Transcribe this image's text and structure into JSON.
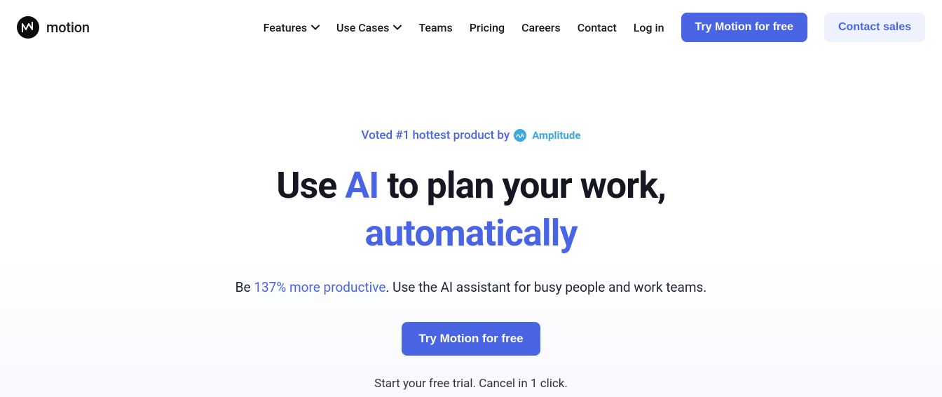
{
  "logo": {
    "text": "motion"
  },
  "nav": {
    "features": "Features",
    "use_cases": "Use Cases",
    "teams": "Teams",
    "pricing": "Pricing",
    "careers": "Careers",
    "contact": "Contact",
    "login": "Log in",
    "try_free": "Try Motion for free",
    "contact_sales": "Contact sales"
  },
  "hero": {
    "badge_text": "Voted #1 hottest product by",
    "badge_brand": "Amplitude",
    "title_1": "Use ",
    "title_ai": "AI",
    "title_2": " to plan your work,",
    "title_3": "automatically",
    "subtitle_1": "Be ",
    "subtitle_accent": "137% more productive",
    "subtitle_2": ". Use the AI assistant for busy people and work teams.",
    "cta": "Try Motion for free",
    "note": "Start your free trial. Cancel in 1 click."
  }
}
